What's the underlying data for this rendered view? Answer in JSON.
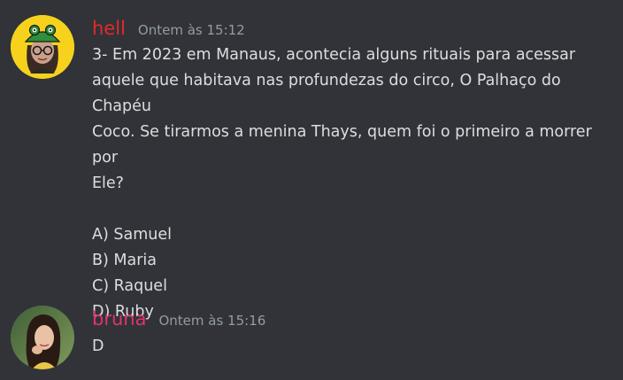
{
  "messages": [
    {
      "author": "hell",
      "author_color": "#e12a2a",
      "timestamp": "Ontem às 15:12",
      "avatar": "frog-hat-girl-avatar",
      "lines": [
        "3- Em 2023 em Manaus, acontecia alguns rituais para acessar",
        "aquele que habitava nas profundezas do circo, O Palhaço do Chapéu",
        "Coco. Se tirarmos a menina Thays, quem foi o primeiro a morrer por",
        "Ele?"
      ],
      "options": [
        "A) Samuel",
        "B) Maria",
        "C) Raquel",
        "D) Ruby"
      ]
    },
    {
      "author": "bruna",
      "author_color": "#e0336b",
      "timestamp": "Ontem às 15:16",
      "avatar": "photo-avatar",
      "text": "D"
    }
  ]
}
